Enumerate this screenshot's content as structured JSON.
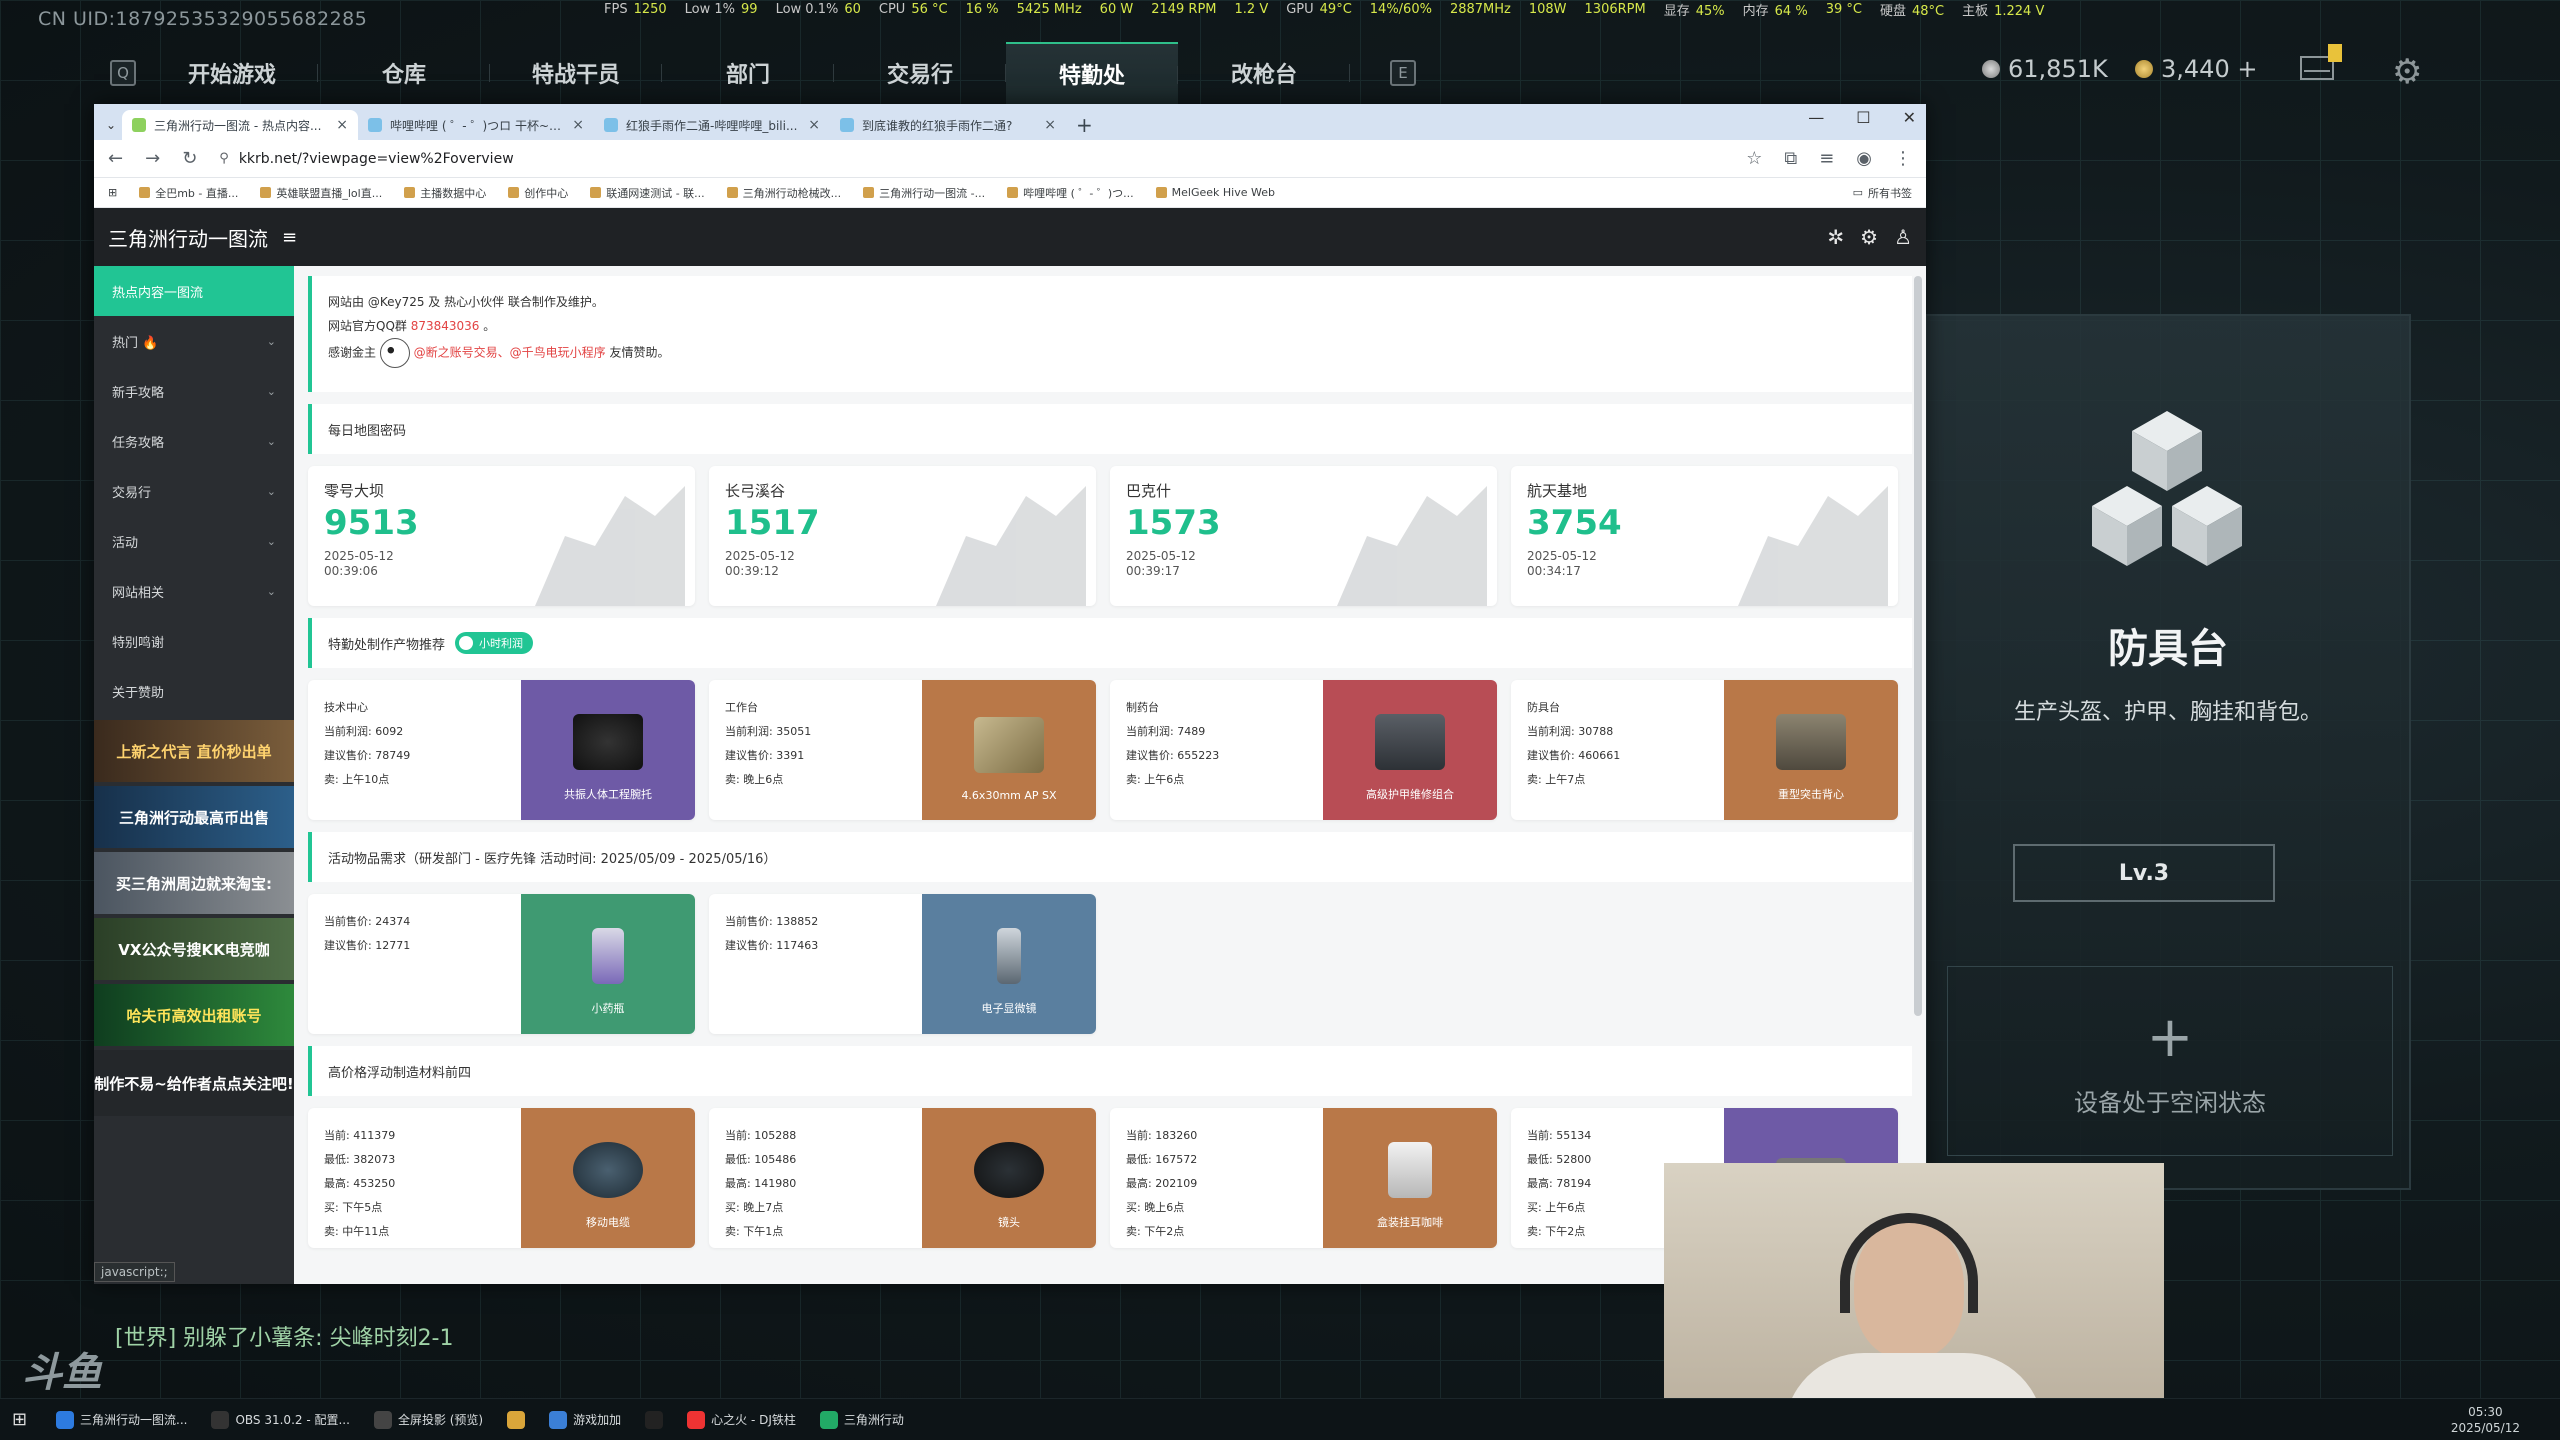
{
  "overlay": {
    "uid": "CN UID:18792535329055682285",
    "perf": [
      {
        "k": "FPS",
        "v": "1250"
      },
      {
        "k": "Low 1%",
        "v": "99"
      },
      {
        "k": "Low 0.1%",
        "v": "60"
      },
      {
        "k": "CPU",
        "v": "56 °C"
      },
      {
        "k": "",
        "v": "16 %"
      },
      {
        "k": "",
        "v": "5425 MHz"
      },
      {
        "k": "",
        "v": "60 W"
      },
      {
        "k": "",
        "v": "2149 RPM"
      },
      {
        "k": "",
        "v": "1.2 V"
      },
      {
        "k": "GPU",
        "v": "49°C"
      },
      {
        "k": "",
        "v": "14%/60%"
      },
      {
        "k": "",
        "v": "2887MHz"
      },
      {
        "k": "",
        "v": "108W"
      },
      {
        "k": "",
        "v": "1306RPM"
      },
      {
        "k": "显存",
        "v": "45%"
      },
      {
        "k": "内存",
        "v": "64 %"
      },
      {
        "k": "",
        "v": "39 °C"
      },
      {
        "k": "硬盘",
        "v": "48°C"
      },
      {
        "k": "主板",
        "v": "1.224 V"
      }
    ]
  },
  "game": {
    "key_left": "Q",
    "key_right": "E",
    "tabs": [
      "开始游戏",
      "仓库",
      "特战干员",
      "部门",
      "交易行",
      "特勤处",
      "改枪台"
    ],
    "active_tab": "特勤处",
    "silver": "61,851K",
    "gold": "3,440 +",
    "panel": {
      "title": "防具台",
      "subtitle": "生产头盔、护甲、胸挂和背包。",
      "level": "Lv.3",
      "idle": "设备处于空闲状态"
    },
    "chat": "[世界] 别躲了小薯条: 尖峰时刻2-1",
    "logo": "斗鱼"
  },
  "browser": {
    "tabs": [
      {
        "title": "三角洲行动一图流 - 热点内容...",
        "active": true
      },
      {
        "title": "哔哩哔哩 ( ゜- ゜)つロ 干杯~-b...",
        "active": false
      },
      {
        "title": "红狼手雨作二通-哔哩哔哩_bili...",
        "active": false
      },
      {
        "title": "到底谁教的红狼手雨作二通?",
        "active": false
      }
    ],
    "url": "kkrb.net/?viewpage=view%2Foverview",
    "bookmarks": [
      "全巴mb - 直播...",
      "英雄联盟直播_lol直...",
      "主播数据中心",
      "创作中心",
      "联通网速测试 - 联...",
      "三角洲行动枪械改...",
      "三角洲行动一图流 -...",
      "哔哩哔哩 ( ゜- ゜)つ...",
      "MelGeek Hive Web"
    ],
    "bookmarks_all": "所有书签",
    "status": "javascript:;"
  },
  "site": {
    "title": "三角洲行动一图流",
    "sidebar": [
      {
        "label": "热点内容一图流",
        "active": true,
        "chev": false
      },
      {
        "label": "热门 🔥",
        "chev": true
      },
      {
        "label": "新手攻略",
        "chev": true
      },
      {
        "label": "任务攻略",
        "chev": true
      },
      {
        "label": "交易行",
        "chev": true
      },
      {
        "label": "活动",
        "chev": true
      },
      {
        "label": "网站相关",
        "chev": true
      },
      {
        "label": "特别鸣谢",
        "chev": false
      },
      {
        "label": "关于赞助",
        "chev": false
      }
    ],
    "ads": [
      "上新之代言 直价秒出单",
      "三角洲行动最高币出售",
      "买三角洲周边就来淘宝:",
      "VX公众号搜KK电竞咖",
      "哈夫币高效出租账号",
      "制作不易~给作者点点关注吧!"
    ],
    "notice": {
      "line1": "网站由 @Key725 及 热心小伙伴 联合制作及维护。",
      "line2_prefix": "网站官方QQ群 ",
      "qq": "873843036",
      "line2_suffix": " 。",
      "line3_prefix": "感谢金主 ",
      "sponsor": "@断之账号交易、@千鸟电玩小程序",
      "line3_suffix": " 友情赞助。"
    },
    "daily_codes_title": "每日地图密码",
    "daily_codes": [
      {
        "name": "零号大坝",
        "code": "9513",
        "date": "2025-05-12",
        "time": "00:39:06"
      },
      {
        "name": "长弓溪谷",
        "code": "1517",
        "date": "2025-05-12",
        "time": "00:39:12"
      },
      {
        "name": "巴克什",
        "code": "1573",
        "date": "2025-05-12",
        "time": "00:39:17"
      },
      {
        "name": "航天基地",
        "code": "3754",
        "date": "2025-05-12",
        "time": "00:34:17"
      }
    ],
    "craft_title": "特勤处制作产物推荐",
    "craft_toggle": "小时利润",
    "crafts": [
      {
        "station": "技术中心",
        "profit": "当前利润: 6092",
        "price": "建议售价: 78749",
        "sell": "卖: 上午10点",
        "item": "共振人体工程腕托",
        "color": "bg-purple",
        "obj": "obj-dark"
      },
      {
        "station": "工作台",
        "profit": "当前利润: 35051",
        "price": "建议售价: 3391",
        "sell": "卖: 晚上6点",
        "item": "4.6x30mm AP SX",
        "color": "bg-orange",
        "obj": "obj-ammo"
      },
      {
        "station": "制药台",
        "profit": "当前利润: 7489",
        "price": "建议售价: 655223",
        "sell": "卖: 上午6点",
        "item": "高级护甲维修组合",
        "color": "bg-red",
        "obj": "obj-kit"
      },
      {
        "station": "防具台",
        "profit": "当前利润: 30788",
        "price": "建议售价: 460661",
        "sell": "卖: 上午7点",
        "item": "重型突击背心",
        "color": "bg-orange",
        "obj": "obj-vest"
      }
    ],
    "event_title": "活动物品需求（研发部门 - 医疗先锋 活动时间: 2025/05/09 - 2025/05/16）",
    "event_items": [
      {
        "cur": "当前售价: 24374",
        "rec": "建议售价: 12771",
        "item": "小药瓶",
        "color": "bg-green",
        "obj": "obj-vial"
      },
      {
        "cur": "当前售价: 138852",
        "rec": "建议售价: 117463",
        "item": "电子显微镜",
        "color": "bg-blue",
        "obj": "obj-scope"
      }
    ],
    "high_title": "高价格浮动制造材料前四",
    "high_items": [
      {
        "lines": [
          "当前: 411379",
          "最低: 382073",
          "最高: 453250",
          "买: 下午5点",
          "卖: 中午11点"
        ],
        "item": "移动电缆",
        "color": "bg-orange",
        "obj": "obj-reel"
      },
      {
        "lines": [
          "当前: 105288",
          "最低: 105486",
          "最高: 141980",
          "买: 晚上7点",
          "卖: 下午1点"
        ],
        "item": "镜头",
        "color": "bg-orange",
        "obj": "obj-lens"
      },
      {
        "lines": [
          "当前: 183260",
          "最低: 167572",
          "最高: 202109",
          "买: 晚上6点",
          "卖: 下午2点"
        ],
        "item": "盒装挂耳咖啡",
        "color": "bg-orange",
        "obj": "obj-coffee"
      },
      {
        "lines": [
          "当前: 55134",
          "最低: 52800",
          "最高: 78194",
          "买: 上午6点",
          "卖: 下午2点"
        ],
        "item": "",
        "color": "bg-purple",
        "obj": "obj-gen"
      }
    ]
  },
  "taskbar": {
    "apps": [
      "三角洲行动一图流...",
      "OBS 31.0.2 - 配置...",
      "全屏投影 (预览)",
      "",
      "游戏加加",
      "",
      "心之火 - DJ铁柱",
      "三角洲行动"
    ],
    "time": "05:30",
    "date": "2025/05/12"
  }
}
